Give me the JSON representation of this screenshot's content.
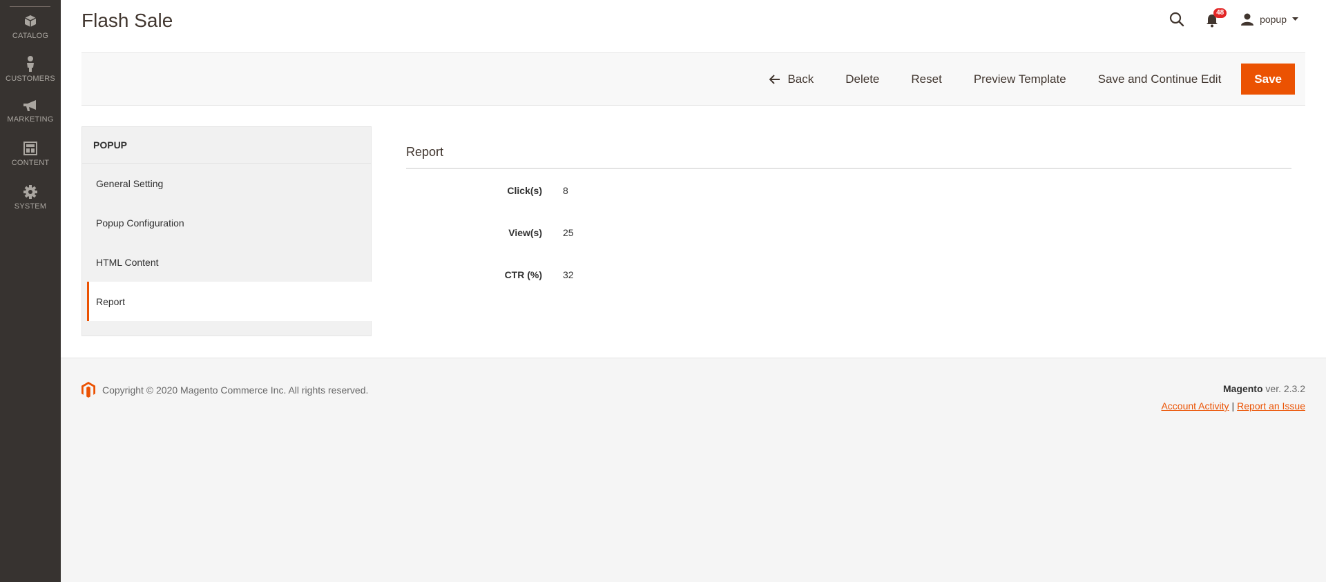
{
  "sidebar": {
    "items": [
      {
        "label": "CATALOG",
        "icon": "catalog-cube-icon"
      },
      {
        "label": "CUSTOMERS",
        "icon": "customers-person-icon"
      },
      {
        "label": "MARKETING",
        "icon": "marketing-megaphone-icon"
      },
      {
        "label": "CONTENT",
        "icon": "content-layout-icon"
      },
      {
        "label": "SYSTEM",
        "icon": "system-gear-icon"
      }
    ]
  },
  "header": {
    "title": "Flash Sale",
    "notification_count": "48",
    "user_name": "popup"
  },
  "actions": {
    "back": "Back",
    "delete": "Delete",
    "reset": "Reset",
    "preview": "Preview Template",
    "save_continue": "Save and Continue Edit",
    "save": "Save"
  },
  "tabs": {
    "title": "POPUP",
    "items": [
      "General Setting",
      "Popup Configuration",
      "HTML Content",
      "Report"
    ],
    "active": "Report"
  },
  "report": {
    "title": "Report",
    "fields": [
      {
        "label": "Click(s)",
        "value": "8"
      },
      {
        "label": "View(s)",
        "value": "25"
      },
      {
        "label": "CTR (%)",
        "value": "32"
      }
    ]
  },
  "footer": {
    "copyright": "Copyright © 2020 Magento Commerce Inc. All rights reserved.",
    "brand": "Magento",
    "version": "ver. 2.3.2",
    "account_activity": "Account Activity",
    "separator": "|",
    "report_issue": "Report an Issue"
  },
  "colors": {
    "accent": "#eb5202",
    "sidebar_bg": "#373330",
    "badge": "#e22626"
  }
}
